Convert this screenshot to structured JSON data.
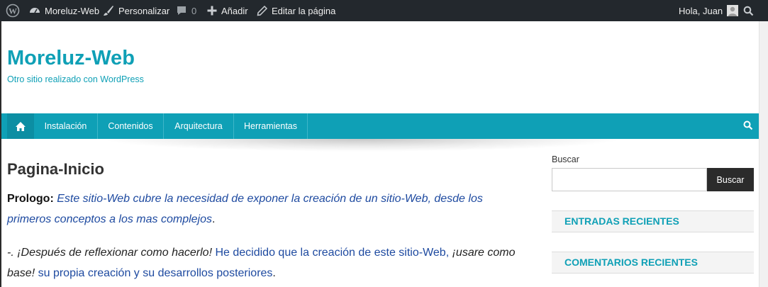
{
  "admin_bar": {
    "site_name": "Moreluz-Web",
    "customize": "Personalizar",
    "comments_count": "0",
    "new": "Añadir",
    "edit_page": "Editar la página",
    "greeting": "Hola, Juan",
    "icons": [
      "wordpress-logo-icon",
      "dashboard-icon",
      "brush-icon",
      "comment-icon",
      "plus-icon",
      "pencil-icon",
      "user-avatar-icon",
      "search-icon"
    ]
  },
  "site": {
    "title": "Moreluz-Web",
    "description": "Otro sitio realizado con WordPress"
  },
  "nav": {
    "items": [
      "Instalación",
      "Contenidos",
      "Arquitectura",
      "Herramientas"
    ],
    "home_icon": "home-icon",
    "search_icon": "search-icon"
  },
  "page": {
    "title": "Pagina-Inicio",
    "p1_bold": "Prologo:",
    "p1_text": " Este sitio-Web cubre la necesidad de exponer la creación de un sitio-Web, desde los primeros conceptos a los mas complejos",
    "p1_end": ".",
    "p2_a": "-. ¡Después de reflexionar como hacerlo! ",
    "p2_b": "He decidido que la creación de este sitio-Web,",
    "p2_c": " ¡usare como base! ",
    "p2_d": "su propia creación y su desarrollos posteriores",
    "p2_end": "."
  },
  "sidebar": {
    "search_label": "Buscar",
    "search_value": "",
    "search_button": "Buscar",
    "recent_posts": "ENTRADAS RECIENTES",
    "recent_comments": "COMENTARIOS RECIENTES"
  },
  "colors": {
    "accent": "#0fa0b6",
    "admin_bar": "#23282d",
    "link": "#1e4aa0"
  }
}
